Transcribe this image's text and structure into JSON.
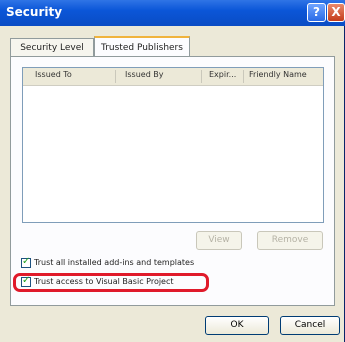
{
  "window": {
    "title": "Security",
    "help_label": "?",
    "close_label": "X"
  },
  "tabs": [
    {
      "label": "Security Level"
    },
    {
      "label": "Trusted Publishers"
    }
  ],
  "list": {
    "columns": [
      "Issued To",
      "Issued By",
      "Expir...",
      "Friendly Name"
    ]
  },
  "list_buttons": {
    "view": "View",
    "remove": "Remove"
  },
  "options": {
    "trust_addins": {
      "label": "Trust all installed add-ins and templates",
      "checked": true
    },
    "trust_vba": {
      "label": "Trust access to Visual Basic Project",
      "checked": true
    }
  },
  "footer": {
    "ok": "OK",
    "cancel": "Cancel"
  },
  "colors": {
    "highlight": "#e01a2a"
  }
}
